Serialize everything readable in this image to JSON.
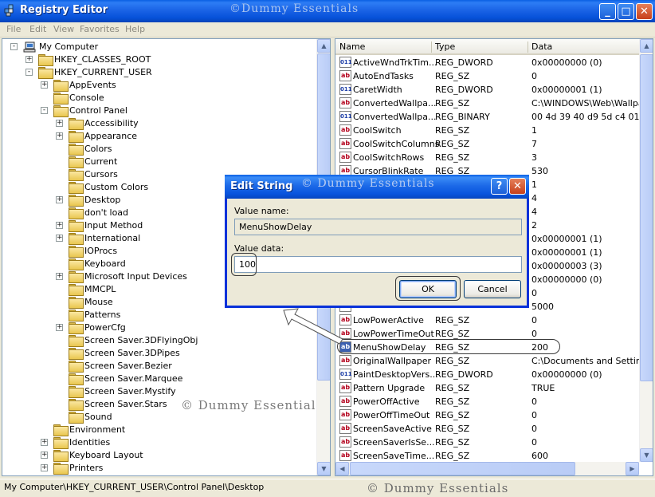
{
  "window": {
    "title": "Registry Editor",
    "watermark": "©Dummy Essentials",
    "minimize": "_",
    "maximize": "□",
    "close": "✕"
  },
  "menu": [
    "File",
    "Edit",
    "View",
    "Favorites",
    "Help"
  ],
  "tree": {
    "watermark": "© Dummy Essentials",
    "items": [
      {
        "label": "My Computer",
        "expander": "-"
      },
      {
        "label": "HKEY_CLASSES_ROOT",
        "expander": "+"
      },
      {
        "label": "HKEY_CURRENT_USER",
        "expander": "-"
      },
      {
        "label": "AppEvents",
        "expander": "+"
      },
      {
        "label": "Console",
        "expander": ""
      },
      {
        "label": "Control Panel",
        "expander": "-"
      },
      {
        "label": "Accessibility",
        "expander": "+"
      },
      {
        "label": "Appearance",
        "expander": "+"
      },
      {
        "label": "Colors",
        "expander": ""
      },
      {
        "label": "Current",
        "expander": ""
      },
      {
        "label": "Cursors",
        "expander": ""
      },
      {
        "label": "Custom Colors",
        "expander": ""
      },
      {
        "label": "Desktop",
        "expander": "+"
      },
      {
        "label": "don't load",
        "expander": ""
      },
      {
        "label": "Input Method",
        "expander": "+"
      },
      {
        "label": "International",
        "expander": "+"
      },
      {
        "label": "IOProcs",
        "expander": ""
      },
      {
        "label": "Keyboard",
        "expander": ""
      },
      {
        "label": "Microsoft Input Devices",
        "expander": "+"
      },
      {
        "label": "MMCPL",
        "expander": ""
      },
      {
        "label": "Mouse",
        "expander": ""
      },
      {
        "label": "Patterns",
        "expander": ""
      },
      {
        "label": "PowerCfg",
        "expander": "+"
      },
      {
        "label": "Screen Saver.3DFlyingObj",
        "expander": ""
      },
      {
        "label": "Screen Saver.3DPipes",
        "expander": ""
      },
      {
        "label": "Screen Saver.Bezier",
        "expander": ""
      },
      {
        "label": "Screen Saver.Marquee",
        "expander": ""
      },
      {
        "label": "Screen Saver.Mystify",
        "expander": ""
      },
      {
        "label": "Screen Saver.Stars",
        "expander": ""
      },
      {
        "label": "Sound",
        "expander": ""
      },
      {
        "label": "Environment",
        "expander": ""
      },
      {
        "label": "Identities",
        "expander": "+"
      },
      {
        "label": "Keyboard Layout",
        "expander": "+"
      },
      {
        "label": "Printers",
        "expander": "+"
      }
    ]
  },
  "list": {
    "columns": {
      "name": "Name",
      "type": "Type",
      "data": "Data"
    },
    "rows": [
      {
        "name": "ActiveWndTrkTim...",
        "type": "REG_DWORD",
        "data": "0x00000000 (0)",
        "icon": "bin"
      },
      {
        "name": "AutoEndTasks",
        "type": "REG_SZ",
        "data": "0",
        "icon": "sz"
      },
      {
        "name": "CaretWidth",
        "type": "REG_DWORD",
        "data": "0x00000001 (1)",
        "icon": "bin"
      },
      {
        "name": "ConvertedWallpa...",
        "type": "REG_SZ",
        "data": "C:\\WINDOWS\\Web\\Wallpap",
        "icon": "sz"
      },
      {
        "name": "ConvertedWallpa...",
        "type": "REG_BINARY",
        "data": "00 4d 39 40 d9 5d c4 01",
        "icon": "bin"
      },
      {
        "name": "CoolSwitch",
        "type": "REG_SZ",
        "data": "1",
        "icon": "sz"
      },
      {
        "name": "CoolSwitchColumns",
        "type": "REG_SZ",
        "data": "7",
        "icon": "sz"
      },
      {
        "name": "CoolSwitchRows",
        "type": "REG_SZ",
        "data": "3",
        "icon": "sz"
      },
      {
        "name": "CursorBlinkRate",
        "type": "REG_SZ",
        "data": "530",
        "icon": "sz"
      },
      {
        "name": "",
        "type": "",
        "data": "1",
        "icon": "sz"
      },
      {
        "name": "",
        "type": "",
        "data": "4",
        "icon": "sz"
      },
      {
        "name": "",
        "type": "",
        "data": "4",
        "icon": "sz"
      },
      {
        "name": "",
        "type": "",
        "data": "2",
        "icon": "sz"
      },
      {
        "name": "",
        "type": "",
        "data": "0x00000001 (1)",
        "icon": "bin"
      },
      {
        "name": "",
        "type": "",
        "data": "0x00000001 (1)",
        "icon": "bin"
      },
      {
        "name": "",
        "type": "",
        "data": "0x00000003 (3)",
        "icon": "bin"
      },
      {
        "name": "",
        "type": "",
        "data": "0x00000000 (0)",
        "icon": "bin"
      },
      {
        "name": "",
        "type": "",
        "data": "0",
        "icon": "sz"
      },
      {
        "name": "",
        "type": "",
        "data": "5000",
        "icon": "sz"
      },
      {
        "name": "LowPowerActive",
        "type": "REG_SZ",
        "data": "0",
        "icon": "sz"
      },
      {
        "name": "LowPowerTimeOut",
        "type": "REG_SZ",
        "data": "0",
        "icon": "sz"
      },
      {
        "name": "MenuShowDelay",
        "type": "REG_SZ",
        "data": "200",
        "icon": "sz",
        "selected": true
      },
      {
        "name": "OriginalWallpaper",
        "type": "REG_SZ",
        "data": "C:\\Documents and Settings\\",
        "icon": "sz"
      },
      {
        "name": "PaintDesktopVers...",
        "type": "REG_DWORD",
        "data": "0x00000000 (0)",
        "icon": "bin"
      },
      {
        "name": "Pattern Upgrade",
        "type": "REG_SZ",
        "data": "TRUE",
        "icon": "sz"
      },
      {
        "name": "PowerOffActive",
        "type": "REG_SZ",
        "data": "0",
        "icon": "sz"
      },
      {
        "name": "PowerOffTimeOut",
        "type": "REG_SZ",
        "data": "0",
        "icon": "sz"
      },
      {
        "name": "ScreenSaveActive",
        "type": "REG_SZ",
        "data": "0",
        "icon": "sz"
      },
      {
        "name": "ScreenSaverIsSe...",
        "type": "REG_SZ",
        "data": "0",
        "icon": "sz"
      },
      {
        "name": "ScreenSaveTime...",
        "type": "REG_SZ",
        "data": "600",
        "icon": "sz"
      }
    ]
  },
  "dialog": {
    "title": "Edit String",
    "watermark": "© Dummy Essentials",
    "help": "?",
    "close": "✕",
    "value_name_label": "Value name:",
    "value_name": "MenuShowDelay",
    "value_data_label": "Value data:",
    "value_data": "100",
    "ok": "OK",
    "cancel": "Cancel"
  },
  "status": {
    "path": "My Computer\\HKEY_CURRENT_USER\\Control Panel\\Desktop",
    "watermark": "© Dummy Essentials"
  },
  "icons": {
    "sz": "ab",
    "bin": "011"
  },
  "colors": {
    "titlebar": "#0a5fe3",
    "selection": "#316ac5",
    "close_button": "#c7401b"
  }
}
